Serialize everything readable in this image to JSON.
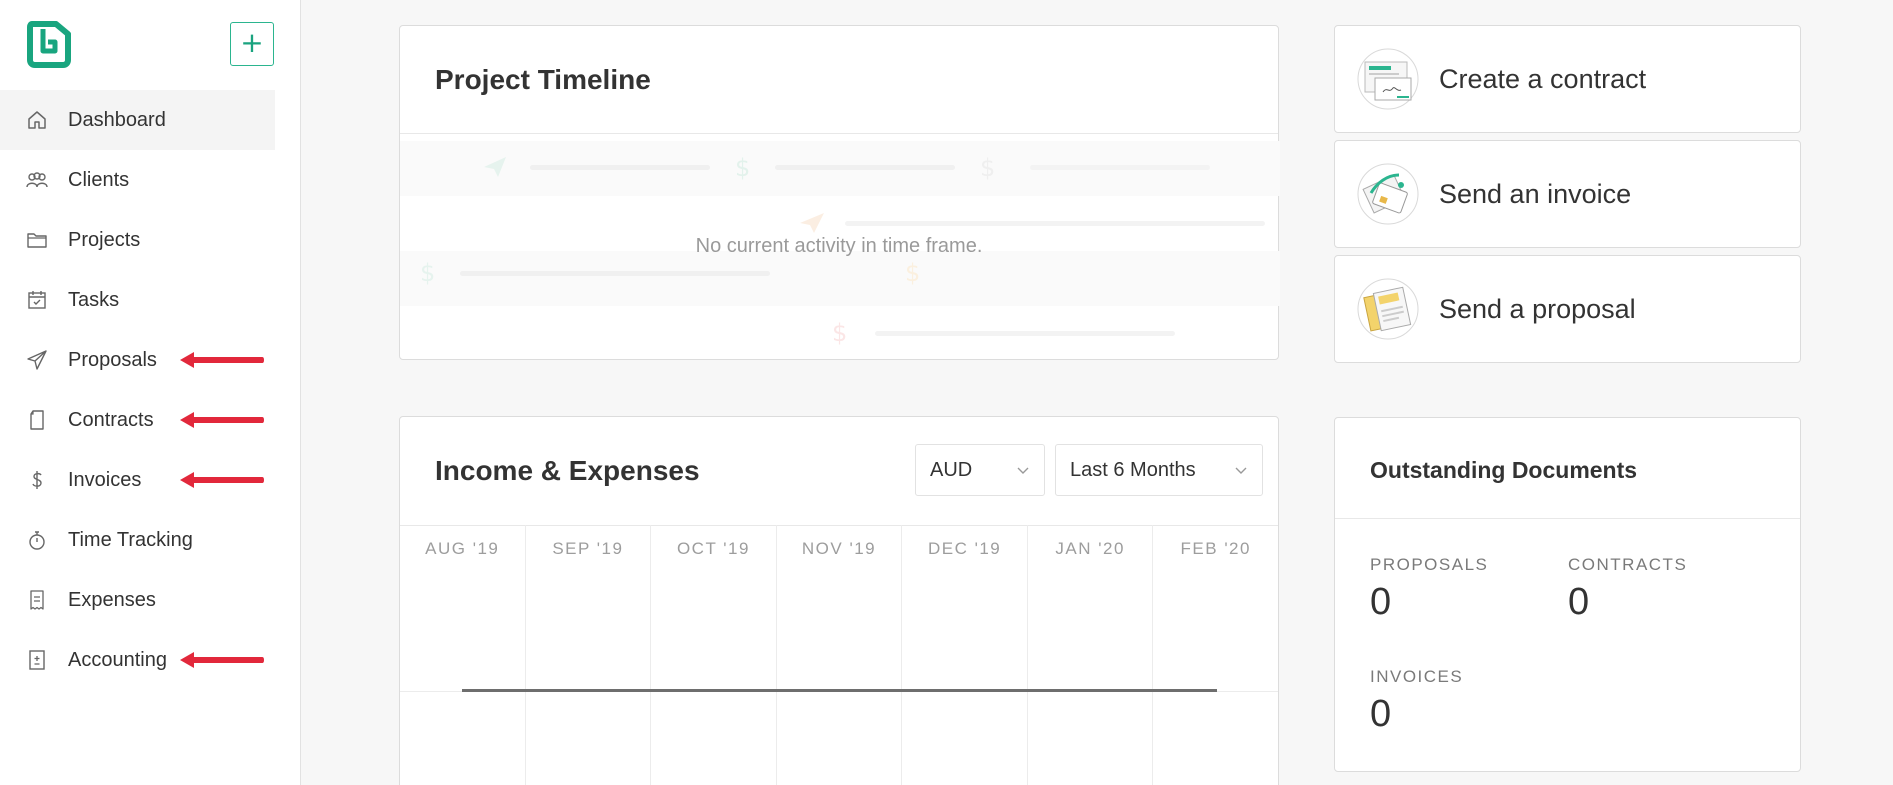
{
  "brand": {
    "accent": "#1aa37f",
    "arrow_color": "#e2283b"
  },
  "sidebar": {
    "add_label": "+",
    "items": [
      {
        "label": "Dashboard",
        "icon": "home-icon",
        "active": true
      },
      {
        "label": "Clients",
        "icon": "clients-icon"
      },
      {
        "label": "Projects",
        "icon": "folder-icon"
      },
      {
        "label": "Tasks",
        "icon": "calendar-check-icon"
      },
      {
        "label": "Proposals",
        "icon": "paper-plane-icon"
      },
      {
        "label": "Contracts",
        "icon": "document-icon"
      },
      {
        "label": "Invoices",
        "icon": "dollar-icon"
      },
      {
        "label": "Time Tracking",
        "icon": "stopwatch-icon"
      },
      {
        "label": "Expenses",
        "icon": "receipt-icon"
      },
      {
        "label": "Accounting",
        "icon": "ledger-icon"
      }
    ]
  },
  "timeline": {
    "title": "Project Timeline",
    "empty_message": "No current activity in time frame."
  },
  "income": {
    "title": "Income & Expenses",
    "currency": "AUD",
    "range": "Last 6 Months",
    "months": [
      "AUG '19",
      "SEP '19",
      "OCT '19",
      "NOV '19",
      "DEC '19",
      "JAN '20",
      "FEB '20"
    ]
  },
  "actions": [
    {
      "label": "Create a contract",
      "icon": "contract-illustration-icon"
    },
    {
      "label": "Send an invoice",
      "icon": "invoice-illustration-icon"
    },
    {
      "label": "Send a proposal",
      "icon": "proposal-illustration-icon"
    }
  ],
  "outstanding": {
    "title": "Outstanding Documents",
    "proposals": {
      "label": "PROPOSALS",
      "value": "0"
    },
    "contracts": {
      "label": "CONTRACTS",
      "value": "0"
    },
    "invoices": {
      "label": "INVOICES",
      "value": "0"
    }
  }
}
